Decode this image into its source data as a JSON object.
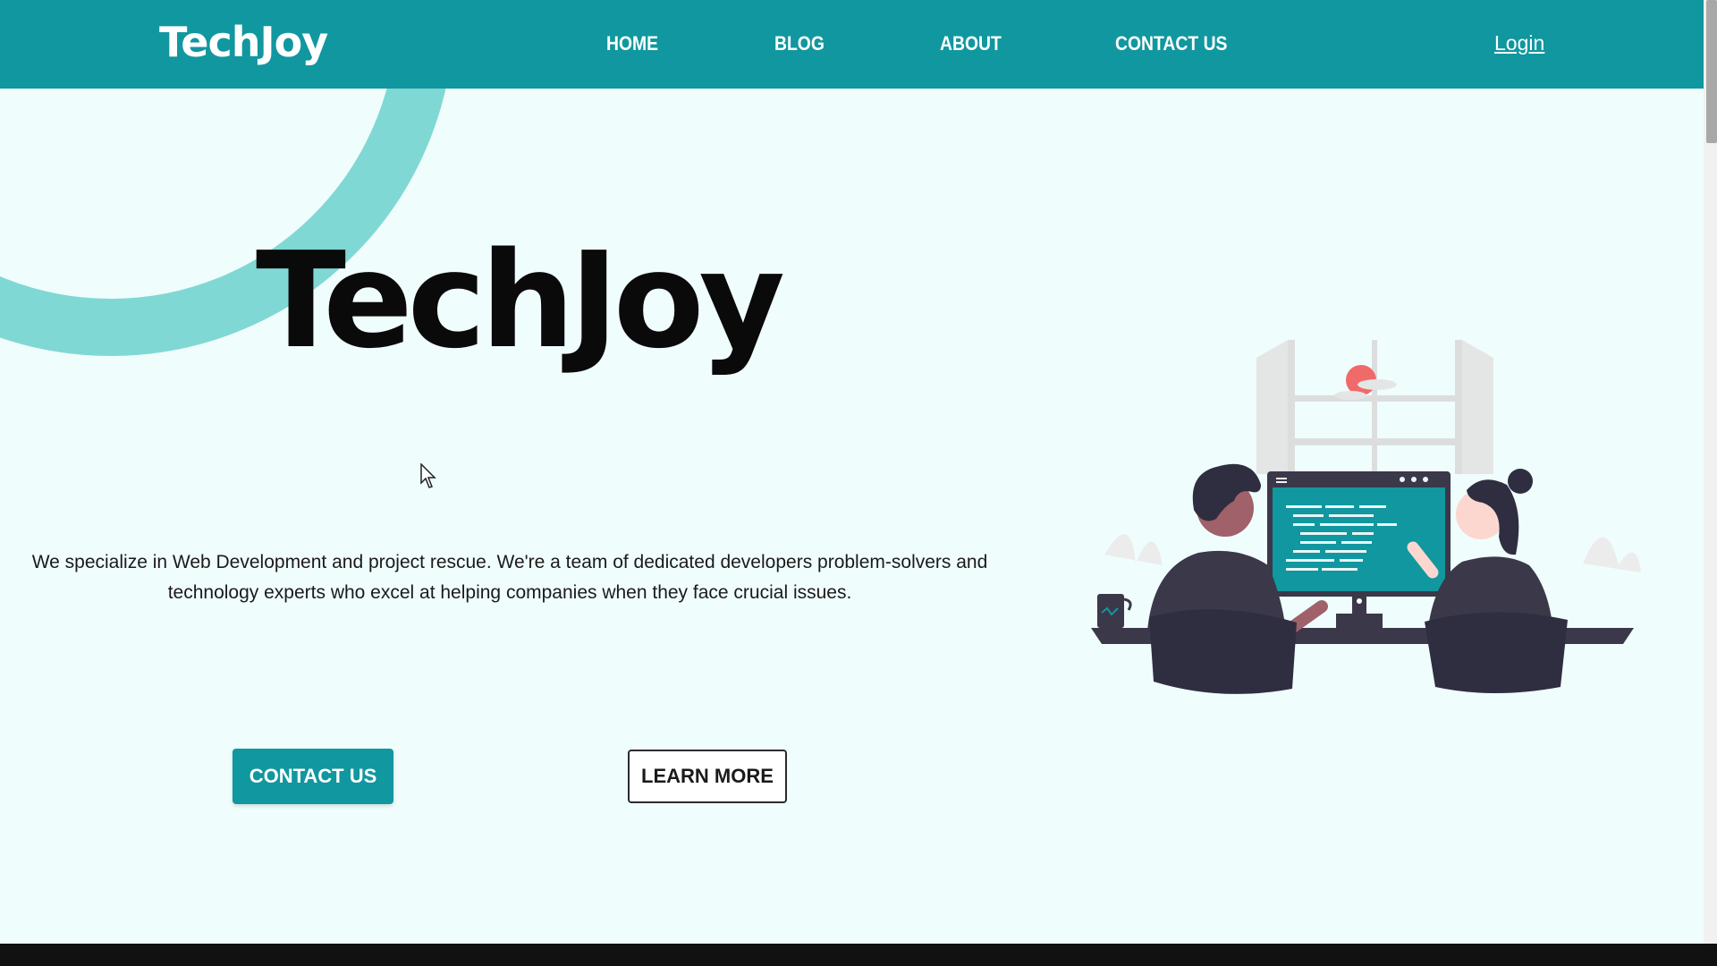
{
  "nav": {
    "brand": "TechJoy",
    "links": [
      {
        "label": "HOME"
      },
      {
        "label": "BLOG"
      },
      {
        "label": "ABOUT"
      },
      {
        "label": "CONTACT US"
      }
    ],
    "login": "Login"
  },
  "hero": {
    "title": "TechJoy",
    "description": "We specialize in Web Development and project rescue. We're a team of dedicated developers problem-solvers and technology experts who excel at helping companies when they face crucial issues.",
    "primary_button": "CONTACT US",
    "secondary_button": "LEARN MORE"
  },
  "illustration": {
    "icon": "developers-at-computer-illustration"
  },
  "colors": {
    "brand_teal": "#11979f",
    "accent_ring": "#80d8d4",
    "page_background": "#f0fdfd",
    "figure_dark": "#3a3849",
    "screen_teal": "#11979f",
    "sun_red": "#f06a6a"
  }
}
